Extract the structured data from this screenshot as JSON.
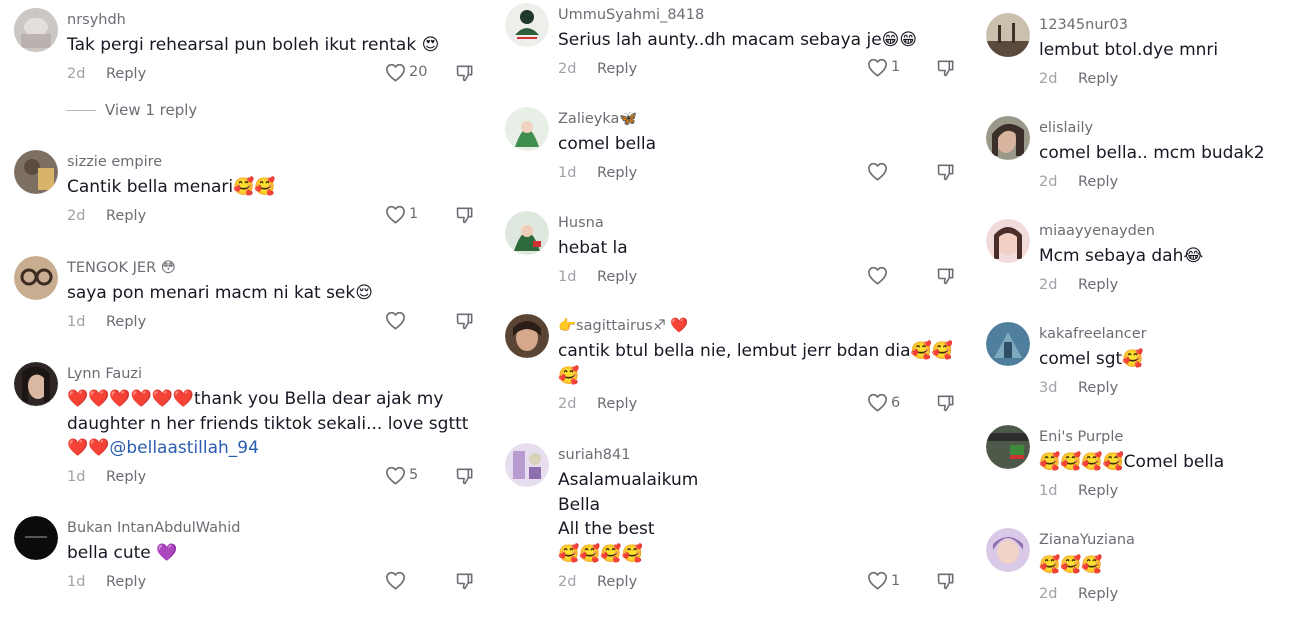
{
  "comments": [
    {
      "user": "nrsyhdh",
      "text": "Tak pergi rehearsal pun boleh ikut rentak 😍",
      "date": "2d",
      "reply": "Reply",
      "likes": "20",
      "avatar_color": "#c9c4c2"
    },
    {
      "user": "sizzie empire",
      "text": "Cantik bella menari🥰🥰",
      "date": "2d",
      "reply": "Reply",
      "likes": "1",
      "avatar_color": "#8a7a66"
    },
    {
      "user": "TENGOK JER 😳",
      "text": "saya pon menari macm ni kat sek😌",
      "date": "1d",
      "reply": "Reply",
      "likes": "",
      "avatar_color": "#b59a7e"
    },
    {
      "user": "Lynn Fauzi",
      "text": "❤️❤️❤️❤️❤️❤️thank you Bella dear ajak my\ndaughter n her friends tiktok sekali... love sgttt\n❤️❤️",
      "mention": "@bellaastillah_94",
      "date": "1d",
      "reply": "Reply",
      "likes": "5",
      "avatar_color": "#3a3130"
    },
    {
      "user": "Bukan IntanAbdulWahid",
      "text": "bella cute 💜",
      "date": "1d",
      "reply": "Reply",
      "likes": "",
      "avatar_color": "#0b0b0b"
    },
    {
      "user": "UmmuSyahmi_8418",
      "text": "Serius lah aunty..dh macam sebaya je😁😁",
      "date": "2d",
      "reply": "Reply",
      "likes": "1",
      "avatar_color": "#e9eae6"
    },
    {
      "user": "Zalieyka🦋",
      "text": "comel bella",
      "date": "1d",
      "reply": "Reply",
      "likes": "",
      "avatar_color": "#3f8f4e"
    },
    {
      "user": "Husna",
      "text": "hebat la",
      "date": "1d",
      "reply": "Reply",
      "likes": "",
      "avatar_color": "#2e6a3c"
    },
    {
      "user": "👉sagittairus♐ ❤️",
      "text": "cantik btul bella nie, lembut jerr bdan dia🥰🥰\n🥰",
      "date": "2d",
      "reply": "Reply",
      "likes": "6",
      "avatar_color": "#5a4433"
    },
    {
      "user": "suriah841",
      "text": "Asalamualaikum\nBella\nAll the best\n🥰🥰🥰🥰",
      "date": "2d",
      "reply": "Reply",
      "likes": "1",
      "avatar_color": "#b99ccf"
    },
    {
      "user": "12345nur03",
      "text": "lembut btol.dye mnri",
      "date": "2d",
      "reply": "Reply",
      "likes": "",
      "avatar_color": "#7a6a5a"
    },
    {
      "user": "elislaily",
      "text": "comel bella.. mcm budak2",
      "date": "2d",
      "reply": "Reply",
      "likes": "",
      "avatar_color": "#8e8c7d"
    },
    {
      "user": "miaayyenayden",
      "text": "Mcm sebaya dah😂",
      "date": "2d",
      "reply": "Reply",
      "likes": "",
      "avatar_color": "#e8c9c9"
    },
    {
      "user": "kakafreelancer",
      "text": "comel sgt🥰",
      "date": "3d",
      "reply": "Reply",
      "likes": "",
      "avatar_color": "#4f7f9b"
    },
    {
      "user": "Eni's Purple",
      "text": "🥰🥰🥰🥰Comel bella",
      "date": "1d",
      "reply": "Reply",
      "likes": "",
      "avatar_color": "#4d5a49"
    },
    {
      "user": "ZianaYuziana",
      "text": "🥰🥰🥰",
      "date": "2d",
      "reply": "Reply",
      "likes": "",
      "avatar_color": "#c9b5d8"
    }
  ],
  "view_replies": "View 1 reply",
  "icons": {
    "like": "heart-outline-icon",
    "dislike": "thumbs-down-icon"
  }
}
